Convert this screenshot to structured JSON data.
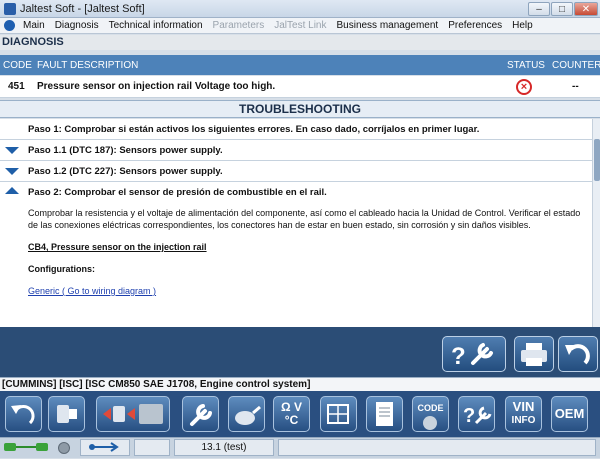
{
  "window": {
    "title": "Jaltest Soft - [Jaltest Soft]",
    "min": "–",
    "max": "□",
    "close": "✕"
  },
  "menu": [
    "Main",
    "Diagnosis",
    "Technical information",
    "Parameters",
    "JalTest Link",
    "Business management",
    "Preferences",
    "Help"
  ],
  "menu_disabled": [
    false,
    false,
    false,
    true,
    true,
    false,
    false,
    false
  ],
  "diagnosis": {
    "title": "DIAGNOSIS",
    "columns": {
      "code": "CODE",
      "fault": "FAULT DESCRIPTION",
      "status": "STATUS",
      "counter": "COUNTER"
    },
    "fault": {
      "code": "451",
      "description": "Pressure sensor on injection rail Voltage too high.",
      "counter": "--"
    }
  },
  "troubleshooting": {
    "title": "TROUBLESHOOTING",
    "steps": [
      {
        "arrow": "none",
        "text": "Paso 1: Comprobar si están activos los siguientes errores. En caso dado, corríjalos en primer lugar."
      },
      {
        "arrow": "down",
        "text": "Paso 1.1 (DTC 187): Sensors power supply."
      },
      {
        "arrow": "down",
        "text": "Paso 1.2 (DTC 227): Sensors power supply."
      },
      {
        "arrow": "up",
        "text": "Paso 2: Comprobar el sensor de presión de combustible en el rail."
      }
    ],
    "detail": {
      "paragraph": "Comprobar la resistencia y el voltaje de alimentación del componente, así como el cableado hacia la Unidad de Control. Verificar el estado de las conexiones eléctricas correspondientes, los conectores han de estar en buen estado, sin corrosión y sin daños visibles.",
      "cb4_link": "CB4, Pressure sensor on the injection rail",
      "configurations": "Configurations:",
      "generic_link": "Generic ( Go to wiring diagram )"
    }
  },
  "system_line": "[CUMMINS] [ISC] [ISC CM850 SAE J1708, Engine control system]",
  "iconbar": {
    "vin_line1": "VIN",
    "vin_line2": "INFO",
    "oem": "OEM",
    "code": "CODE",
    "ohm": "Ω V",
    "ohm2": "°C"
  },
  "bottom": {
    "version": "13.1 (test)"
  }
}
